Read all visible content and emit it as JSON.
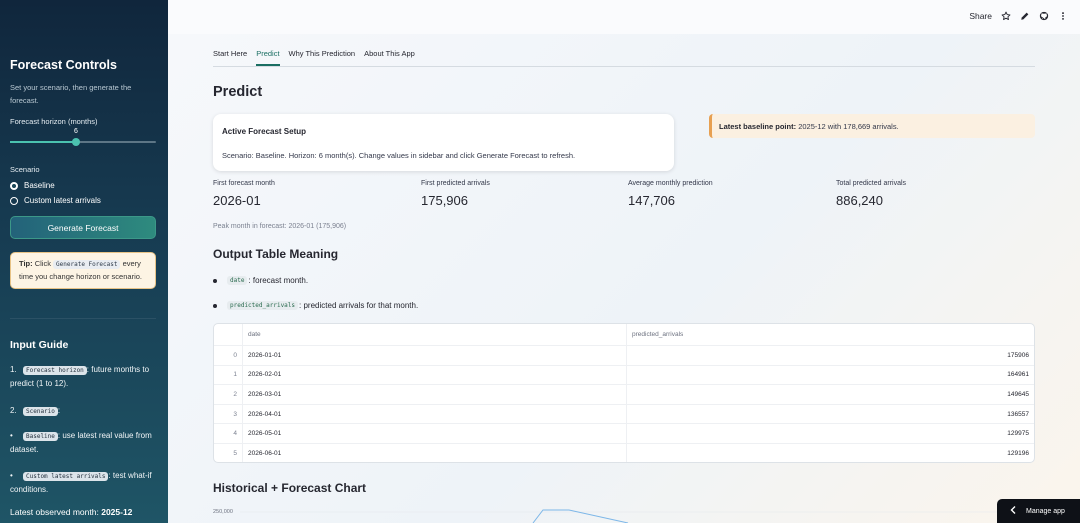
{
  "sidebar": {
    "title": "Forecast Controls",
    "description": "Set your scenario, then generate the forecast.",
    "horizon_label": "Forecast horizon (months)",
    "horizon_value": "6",
    "horizon_fraction": 0.4545,
    "scenario_label": "Scenario",
    "scenario_options": [
      "Baseline",
      "Custom latest arrivals"
    ],
    "scenario_selected": "Baseline",
    "generate_button": "Generate Forecast",
    "tip": {
      "prefix": "Tip:",
      "text_before": "Click",
      "code": "Generate Forecast",
      "text_after": "every time you change horizon or scenario."
    },
    "input_guide": {
      "title": "Input Guide",
      "items": [
        {
          "marker": "1.",
          "code": "Forecast horizon",
          "text": ": future months to predict (1 to 12)."
        },
        {
          "marker": "2.",
          "code": "Scenario",
          "text": ":"
        },
        {
          "marker": "•",
          "code": "Baseline",
          "text": ": use latest real value from dataset."
        },
        {
          "marker": "•",
          "code": "Custom latest arrivals",
          "text": ": test what-if conditions."
        }
      ]
    },
    "latest_observed_label": "Latest observed month:",
    "latest_observed_value": "2025-12"
  },
  "topbar": {
    "share_label": "Share",
    "icons": [
      "star-icon",
      "edit-icon",
      "github-icon",
      "more-vertical-icon"
    ]
  },
  "tabs": [
    "Start Here",
    "Predict",
    "Why This Prediction",
    "About This App"
  ],
  "active_tab": "Predict",
  "page_title": "Predict",
  "setup_card": {
    "title": "Active Forecast Setup",
    "text": "Scenario: Baseline. Horizon: 6 month(s). Change values in sidebar and click Generate Forecast to refresh."
  },
  "notice": {
    "bold": "Latest baseline point:",
    "text": " 2025-12 with 178,669 arrivals."
  },
  "metrics": [
    {
      "label": "First forecast month",
      "value": "2026-01"
    },
    {
      "label": "First predicted arrivals",
      "value": "175,906"
    },
    {
      "label": "Average monthly prediction",
      "value": "147,706"
    },
    {
      "label": "Total predicted arrivals",
      "value": "886,240"
    }
  ],
  "peak_text": "Peak month in forecast: 2026-01 (175,906)",
  "output_meaning": {
    "title": "Output Table Meaning",
    "items": [
      {
        "code": "date",
        "text": ": forecast month."
      },
      {
        "code": "predicted_arrivals",
        "text": ": predicted arrivals for that month."
      }
    ]
  },
  "table": {
    "columns": [
      "date",
      "predicted_arrivals"
    ],
    "rows": [
      {
        "index": "0",
        "date": "2026-01-01",
        "predicted_arrivals": "175906"
      },
      {
        "index": "1",
        "date": "2026-02-01",
        "predicted_arrivals": "164961"
      },
      {
        "index": "2",
        "date": "2026-03-01",
        "predicted_arrivals": "149645"
      },
      {
        "index": "3",
        "date": "2026-04-01",
        "predicted_arrivals": "136557"
      },
      {
        "index": "4",
        "date": "2026-05-01",
        "predicted_arrivals": "129975"
      },
      {
        "index": "5",
        "date": "2026-06-01",
        "predicted_arrivals": "129196"
      }
    ]
  },
  "chart": {
    "title": "Historical + Forecast Chart",
    "y_tick_top": "250,000",
    "line_color": "#7db7e8"
  },
  "manage_app": "Manage app"
}
